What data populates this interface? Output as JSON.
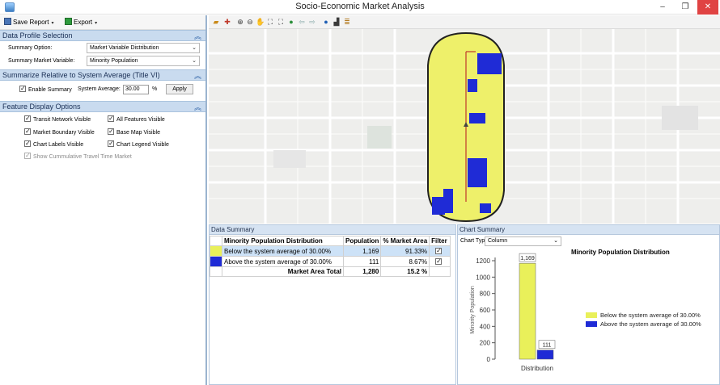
{
  "window": {
    "title": "Socio-Economic Market Analysis",
    "min_glyph": "–",
    "max_glyph": "❐",
    "close_glyph": "✕"
  },
  "toolbar": {
    "save_label": "Save Report",
    "export_label": "Export",
    "dropdown_glyph": "▾"
  },
  "data_profile": {
    "header": "Data Profile Selection",
    "summary_option_label": "Summary Option:",
    "summary_option_value": "Market Variable Distribution",
    "market_variable_label": "Summary Market Variable:",
    "market_variable_value": "Minority Population"
  },
  "summarize": {
    "header": "Summarize Relative to System Average (Title VI)",
    "enable_label": "Enable Summary",
    "enable_checked": true,
    "system_average_label": "System Average:",
    "system_average_value": "30.00",
    "unit": "%",
    "apply_label": "Apply"
  },
  "feature_display": {
    "header": "Feature Display Options",
    "options": [
      {
        "label": "Transit Network Visible",
        "checked": true
      },
      {
        "label": "All Features Visible",
        "checked": true
      },
      {
        "label": "Market Boundary Visible",
        "checked": true
      },
      {
        "label": "Base Map Visible",
        "checked": true
      },
      {
        "label": "Chart Labels Visible",
        "checked": true
      },
      {
        "label": "Chart Legend Visible",
        "checked": true
      }
    ],
    "cumulative_label": "Show Cummulative Travel Time Market"
  },
  "data_summary": {
    "title": "Data Summary",
    "columns": [
      "Minority Population Distribution",
      "Population",
      "% Market Area",
      "Filter"
    ],
    "rows": [
      {
        "label": "Below the system average of 30.00%",
        "population": "1,169",
        "pct": "91.33%",
        "filter": true,
        "color": "#e9f05a"
      },
      {
        "label": "Above the system average of 30.00%",
        "population": "111",
        "pct": "8.67%",
        "filter": true,
        "color": "#1f2bd6"
      }
    ],
    "total_label": "Market Area Total",
    "total_population": "1,280",
    "total_pct": "15.2 %"
  },
  "chart_summary": {
    "title": "Chart Summary",
    "type_label": "Chart Type:",
    "type_value": "Column"
  },
  "chart_data": {
    "type": "bar",
    "title": "Minority Population Distribution",
    "categories": [
      "Distribution"
    ],
    "series": [
      {
        "name": "Below the system average of 30.00%",
        "values": [
          1169
        ],
        "color": "#e9f05a"
      },
      {
        "name": "Above the system average of 30.00%",
        "values": [
          111
        ],
        "color": "#1f2bd6"
      }
    ],
    "data_labels": [
      "1,169",
      "111"
    ],
    "xlabel": "Distribution",
    "ylabel": "Minority Population",
    "ylim": [
      0,
      1200
    ],
    "yticks": [
      0,
      200,
      400,
      600,
      800,
      1000,
      1200
    ],
    "legend_position": "right"
  }
}
